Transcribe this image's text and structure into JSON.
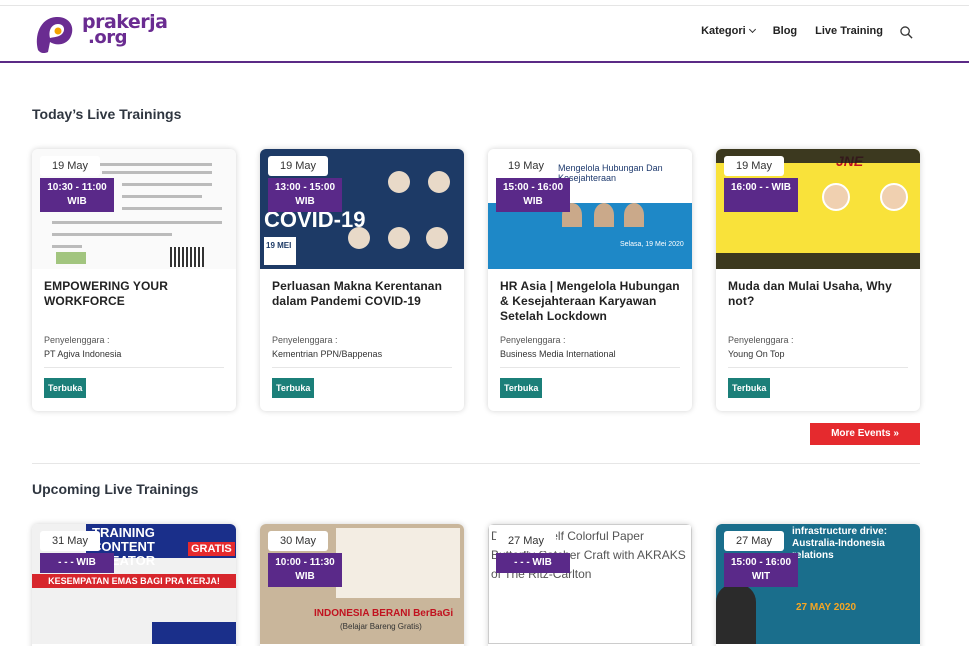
{
  "brand": {
    "logo_line1": "prakerja",
    "logo_line2": ".org"
  },
  "nav": {
    "kategori": "Kategori",
    "blog": "Blog",
    "live_training": "Live Training"
  },
  "sections": {
    "today_title": "Today’s Live Trainings",
    "upcoming_title": "Upcoming Live Trainings",
    "more_events": "More Events »"
  },
  "today": [
    {
      "date": "19 May",
      "time": "10:30 - 11:00 WIB",
      "title": "EMPOWERING YOUR WORKFORCE",
      "org_label": "Penyelenggara :",
      "org": "PT Agiva Indonesia",
      "badge": "Terbuka"
    },
    {
      "date": "19 May",
      "time": "13:00 - 15:00 WIB",
      "title": "Perluasan Makna Kerentanan dalam Pandemi COVID-19",
      "org_label": "Penyelenggara :",
      "org": "Kementrian PPN/Bappenas",
      "badge": "Terbuka"
    },
    {
      "date": "19 May",
      "time": "15:00 - 16:00 WIB",
      "title": "HR Asia | Mengelola Hubungan & Kesejahteraan Karyawan Setelah Lockdown",
      "org_label": "Penyelenggara :",
      "org": "Business Media International",
      "badge": "Terbuka"
    },
    {
      "date": "19 May",
      "time": "16:00 - - WIB",
      "title": "Muda dan Mulai Usaha, Why not?",
      "org_label": "Penyelenggara :",
      "org": "Young On Top",
      "badge": "Terbuka"
    }
  ],
  "upcoming": [
    {
      "date": "31 May",
      "time": "- - - WIB"
    },
    {
      "date": "30 May",
      "time": "10:00 - 11:30 WIB"
    },
    {
      "date": "27 May",
      "time": "- - - WIB"
    },
    {
      "date": "27 May",
      "time": "15:00 - 16:00 WIT"
    }
  ],
  "thumb_text": {
    "covid_big": "COVID-19",
    "covid_date": "19 MEI",
    "hr_line": "Selasa, 19 Mei 2020",
    "hr_title": "Mengelola Hubungan Dan Kesejahteraan",
    "jne_brand": "JNE",
    "content_title": "TRAINING CONTENT CREATOR",
    "content_gratis": "GRATIS",
    "content_tag": "KESEMPATAN EMAS BAGI PRA KERJA!",
    "berani_title": "INDONESIA BERANI BerBaGi",
    "berani_sub": "(Belajar Bareng Gratis)",
    "paper_alt": "Do-It-Yourself Colorful Paper Butterfly Catcher Craft with AKRAKS of The Ritz-Carlton",
    "aus_title": "infrastructure drive: Australia-Indonesia relations",
    "aus_date": "27 MAY 2020"
  },
  "colors": {
    "brand_purple": "#5a2989",
    "badge_teal": "#1b7f79",
    "more_red": "#e52a2e"
  }
}
